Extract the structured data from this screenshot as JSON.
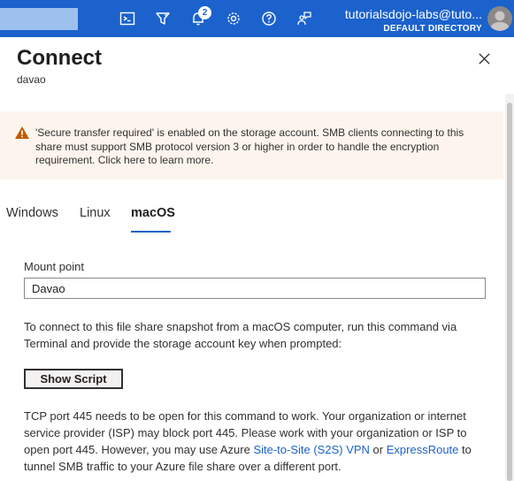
{
  "topbar": {
    "search_placeholder": "",
    "notification_count": "2",
    "account_email": "tutorialsdojo-labs@tuto...",
    "directory": "DEFAULT DIRECTORY",
    "icons": [
      "cloud-shell-icon",
      "directory-filter-icon",
      "notifications-icon",
      "settings-icon",
      "help-icon",
      "feedback-icon"
    ],
    "bg_color": "#1c62cc"
  },
  "panel": {
    "title": "Connect",
    "subtitle": "davao"
  },
  "warning": {
    "text": "'Secure transfer required' is enabled on the storage account. SMB clients connecting to this share must support SMB protocol version 3 or higher in order to handle the encryption requirement. Click here to learn more.",
    "bg_color": "#fdf5ed",
    "icon_color": "#c05a00"
  },
  "tabs": [
    {
      "label": "Windows",
      "active": false
    },
    {
      "label": "Linux",
      "active": false
    },
    {
      "label": "macOS",
      "active": true
    }
  ],
  "mount_point": {
    "label": "Mount point",
    "value": "Davao"
  },
  "instructions": "To connect to this file share snapshot from a macOS computer, run this command via Terminal and provide the storage account key when prompted:",
  "show_script_label": "Show Script",
  "port_info": {
    "text_before": "TCP port 445 needs to be open for this command to work. Your organization or internet service provider (ISP) may block port 445. Please work with your organization or ISP to open port 445. However, you may use Azure ",
    "link1": "Site-to-Site (S2S) VPN",
    "text_middle": " or ",
    "link2": "ExpressRoute",
    "text_after": " to tunnel SMB traffic to your Azure file share over a different port."
  }
}
